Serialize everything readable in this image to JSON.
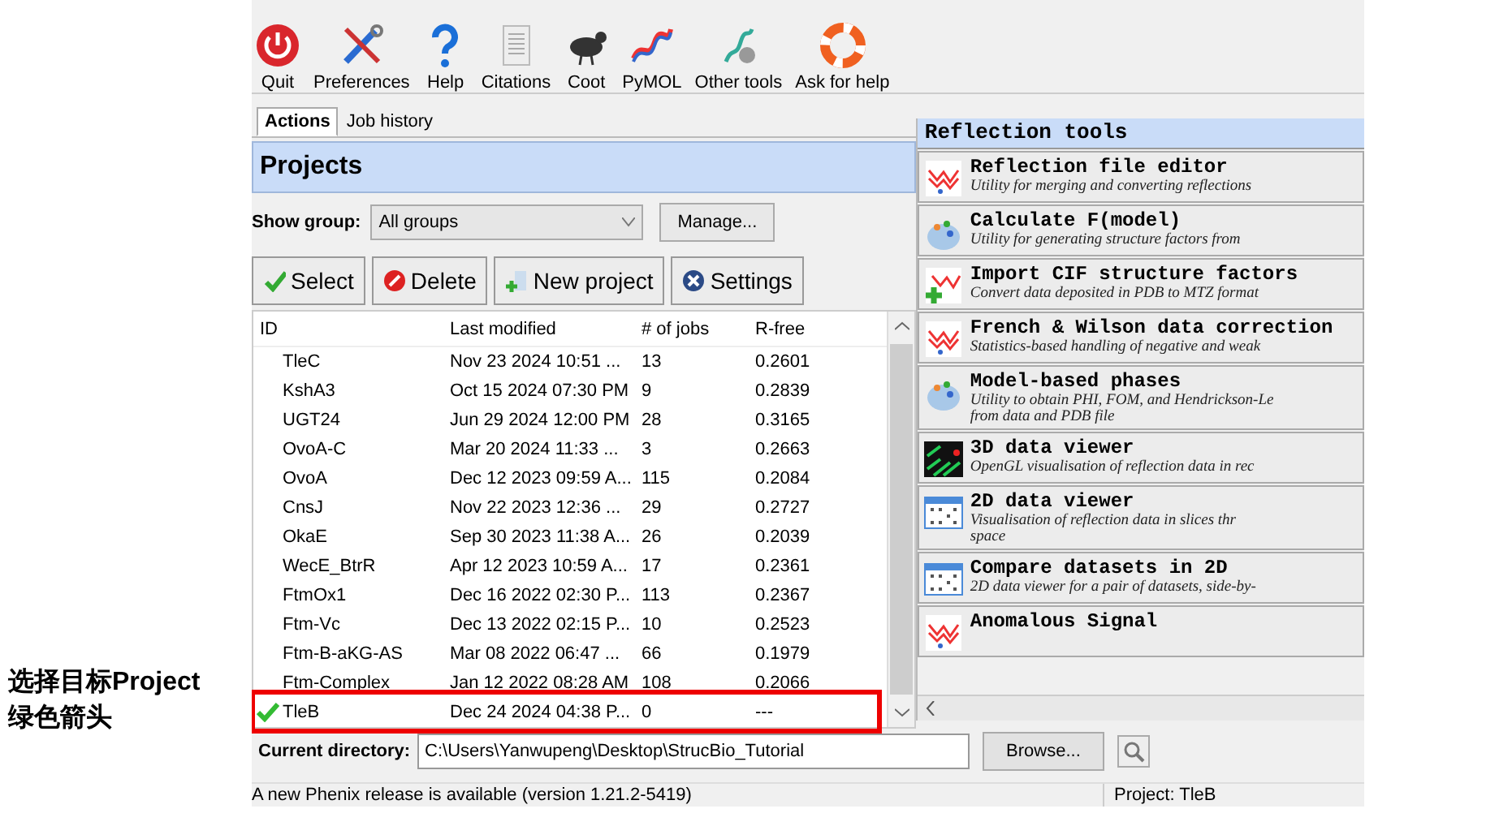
{
  "annotation": {
    "lines": [
      "选择目标Project",
      "绿色箭头"
    ]
  },
  "toolbar": [
    {
      "label": "Quit",
      "kind": "power"
    },
    {
      "label": "Preferences",
      "kind": "tools"
    },
    {
      "label": "Help",
      "kind": "question"
    },
    {
      "label": "Citations",
      "kind": "document"
    },
    {
      "label": "Coot",
      "kind": "bird"
    },
    {
      "label": "PyMOL",
      "kind": "helix"
    },
    {
      "label": "Other tools",
      "kind": "helixgear"
    },
    {
      "label": "Ask for help",
      "kind": "lifebuoy"
    }
  ],
  "tabs": [
    {
      "label": "Actions",
      "selected": true
    },
    {
      "label": "Job history",
      "selected": false
    }
  ],
  "projects_panel": {
    "title": "Projects",
    "show_group_label": "Show group:",
    "group": "All groups",
    "manage_button": "Manage...",
    "buttons": [
      {
        "label": "Select",
        "kind": "check"
      },
      {
        "label": "Delete",
        "kind": "delete"
      },
      {
        "label": "New project",
        "kind": "new"
      },
      {
        "label": "Settings",
        "kind": "settings"
      }
    ]
  },
  "table": {
    "columns": [
      "ID",
      "Last modified",
      "# of jobs",
      "R-free"
    ],
    "rows": [
      {
        "id": "TleC",
        "last_modified": "Nov 23 2024 10:51 ...",
        "jobs": "13",
        "r_free": "0.2601",
        "selected": false
      },
      {
        "id": "KshA3",
        "last_modified": "Oct 15 2024 07:30 PM",
        "jobs": "9",
        "r_free": "0.2839",
        "selected": false
      },
      {
        "id": "UGT24",
        "last_modified": "Jun 29 2024 12:00 PM",
        "jobs": "28",
        "r_free": "0.3165",
        "selected": false
      },
      {
        "id": "OvoA-C",
        "last_modified": "Mar 20 2024 11:33 ...",
        "jobs": "3",
        "r_free": "0.2663",
        "selected": false
      },
      {
        "id": "OvoA",
        "last_modified": "Dec 12 2023 09:59 A...",
        "jobs": "115",
        "r_free": "0.2084",
        "selected": false
      },
      {
        "id": "CnsJ",
        "last_modified": "Nov 22 2023 12:36 ...",
        "jobs": "29",
        "r_free": "0.2727",
        "selected": false
      },
      {
        "id": "OkaE",
        "last_modified": "Sep 30 2023 11:38 A...",
        "jobs": "26",
        "r_free": "0.2039",
        "selected": false
      },
      {
        "id": "WecE_BtrR",
        "last_modified": "Apr 12 2023 10:59 A...",
        "jobs": "17",
        "r_free": "0.2361",
        "selected": false
      },
      {
        "id": "FtmOx1",
        "last_modified": "Dec 16 2022 02:30 P...",
        "jobs": "113",
        "r_free": "0.2367",
        "selected": false
      },
      {
        "id": "Ftm-Vc",
        "last_modified": "Dec 13 2022 02:15 P...",
        "jobs": "10",
        "r_free": "0.2523",
        "selected": false
      },
      {
        "id": "Ftm-B-aKG-AS",
        "last_modified": "Mar 08 2022 06:47 ...",
        "jobs": "66",
        "r_free": "0.1979",
        "selected": false
      },
      {
        "id": "Ftm-Complex",
        "last_modified": "Jan 12 2022 08:28 AM",
        "jobs": "108",
        "r_free": "0.2066",
        "selected": false
      },
      {
        "id": "TleB",
        "last_modified": "Dec 24 2024 04:38 P...",
        "jobs": "0",
        "r_free": "---",
        "selected": true,
        "highlighted": true
      }
    ]
  },
  "tools_panel": {
    "title": "Reflection tools",
    "tools": [
      {
        "title": "Reflection file editor",
        "description": [
          "Utility for merging and converting reflections"
        ],
        "kind": "reflection"
      },
      {
        "title": "Calculate F(model)",
        "description": [
          "Utility for generating structure factors from"
        ],
        "kind": "model"
      },
      {
        "title": "Import CIF structure factors",
        "description": [
          "Convert data deposited in PDB to MTZ format"
        ],
        "kind": "import"
      },
      {
        "title": "French & Wilson data correction",
        "description": [
          "Statistics-based handling of negative and weak"
        ],
        "kind": "reflection"
      },
      {
        "title": "Model-based phases",
        "description": [
          "Utility to obtain PHI, FOM, and Hendrickson-Le",
          "from data and PDB file"
        ],
        "kind": "model"
      },
      {
        "title": "3D data viewer",
        "description": [
          "OpenGL visualisation of reflection data in rec"
        ],
        "kind": "viewer3d"
      },
      {
        "title": "2D data viewer",
        "description": [
          "Visualisation of reflection data in slices thr",
          "space"
        ],
        "kind": "viewer2d"
      },
      {
        "title": "Compare datasets in 2D",
        "description": [
          "2D data viewer for a pair of datasets, side-by-"
        ],
        "kind": "viewer2d"
      },
      {
        "title": "Anomalous Signal",
        "kind": "reflection"
      }
    ]
  },
  "current_directory": {
    "label": "Current directory:",
    "value": "C:\\Users\\Yanwupeng\\Desktop\\StrucBio_Tutorial",
    "browse_button": "Browse..."
  },
  "status_bar": {
    "message": "A new Phenix release is available (version 1.21.2-5419)",
    "project": "Project: TleB"
  }
}
